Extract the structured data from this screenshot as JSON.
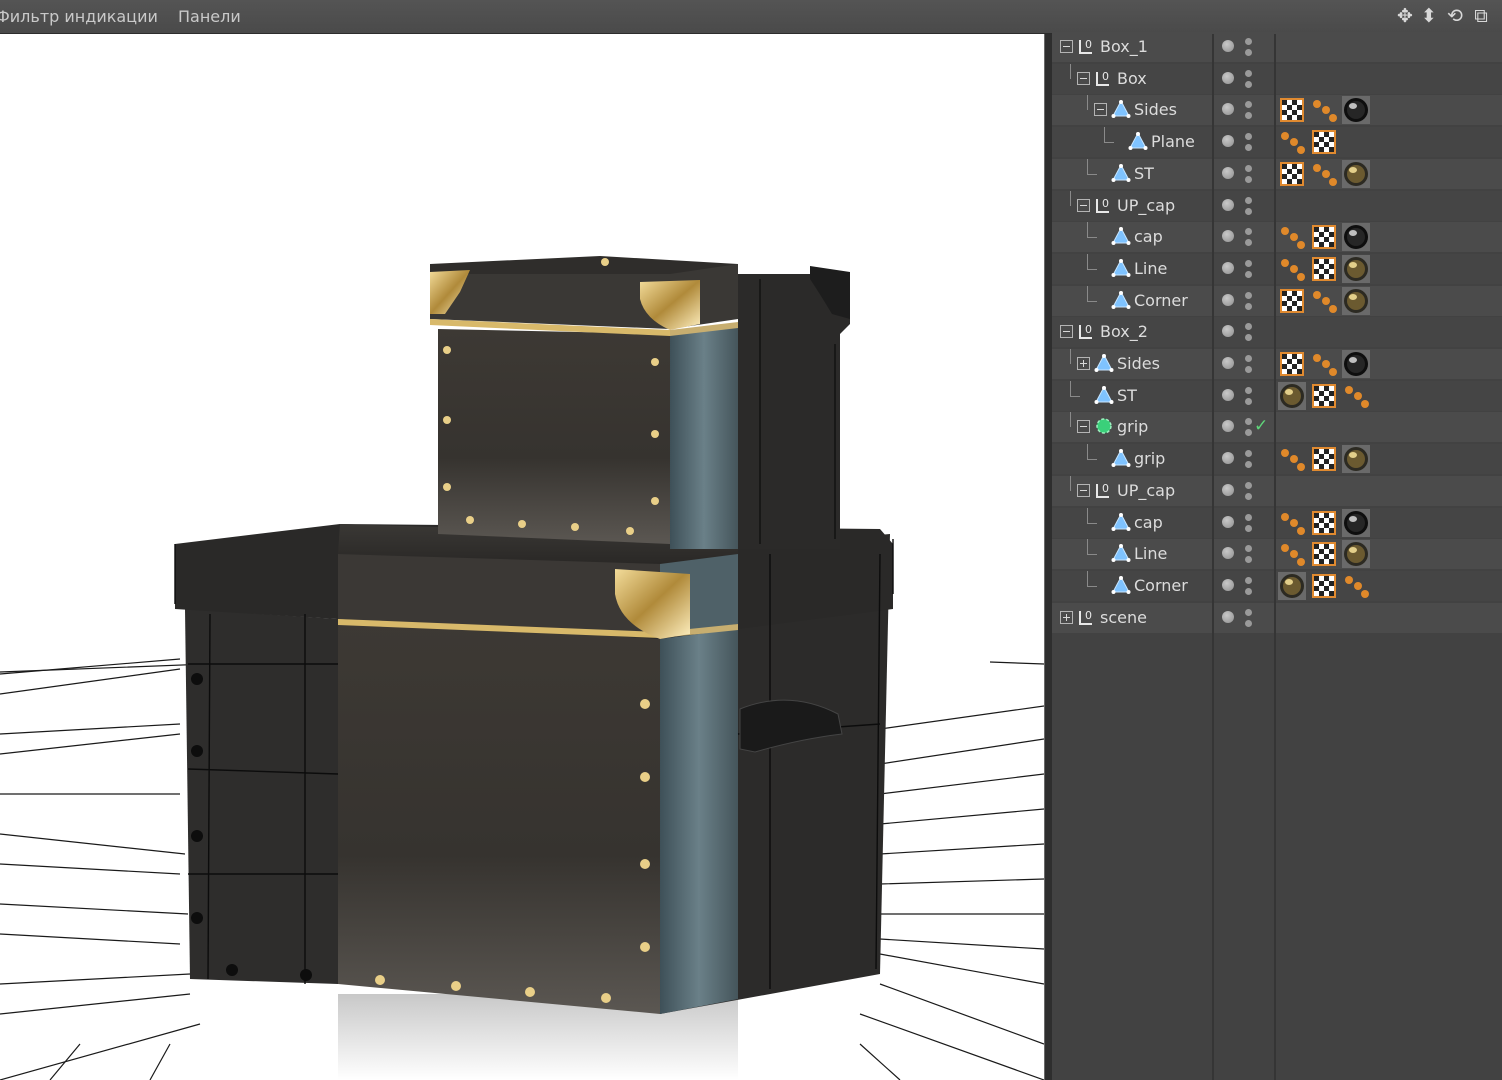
{
  "menu": {
    "items": [
      {
        "label": "Фильтр индикации"
      },
      {
        "label": "Панели"
      }
    ]
  },
  "toolbar": {
    "icons": [
      "move-icon",
      "down-arrow-icon",
      "rotate-icon",
      "window-icon"
    ]
  },
  "object_manager": {
    "objects": [
      {
        "name": "Box_1",
        "depth": 0,
        "kind": "null",
        "expander": "collapse",
        "tags": []
      },
      {
        "name": "Box",
        "depth": 1,
        "kind": "null",
        "expander": "collapse",
        "tags": []
      },
      {
        "name": "Sides",
        "depth": 2,
        "kind": "polygon",
        "expander": "collapse",
        "tags": [
          "texture-tag",
          "selection-tag",
          "material-tag-black"
        ]
      },
      {
        "name": "Plane",
        "depth": 3,
        "kind": "polygon",
        "expander": "none",
        "tags": [
          "selection-tag",
          "texture-tag"
        ]
      },
      {
        "name": "ST",
        "depth": 2,
        "kind": "polygon",
        "expander": "none",
        "tags": [
          "texture-tag",
          "selection-tag",
          "material-tag-gold"
        ]
      },
      {
        "name": "UP_cap",
        "depth": 1,
        "kind": "null",
        "expander": "collapse",
        "tags": []
      },
      {
        "name": "cap",
        "depth": 2,
        "kind": "polygon",
        "expander": "none",
        "tags": [
          "selection-tag",
          "texture-tag",
          "material-tag-black"
        ]
      },
      {
        "name": "Line",
        "depth": 2,
        "kind": "polygon",
        "expander": "none",
        "tags": [
          "selection-tag",
          "texture-tag",
          "material-tag-gold"
        ]
      },
      {
        "name": "Corner",
        "depth": 2,
        "kind": "polygon",
        "expander": "none",
        "tags": [
          "texture-tag",
          "selection-tag",
          "material-tag-gold"
        ]
      },
      {
        "name": "Box_2",
        "depth": 0,
        "kind": "null",
        "expander": "collapse",
        "tags": []
      },
      {
        "name": "Sides",
        "depth": 1,
        "kind": "polygon",
        "expander": "expand",
        "tags": [
          "texture-tag",
          "selection-tag",
          "material-tag-black"
        ]
      },
      {
        "name": "ST",
        "depth": 1,
        "kind": "polygon",
        "expander": "none",
        "tags": [
          "material-tag-gold",
          "texture-tag",
          "selection-tag"
        ]
      },
      {
        "name": "grip",
        "depth": 1,
        "kind": "generator",
        "expander": "collapse",
        "tags": [],
        "checked": true
      },
      {
        "name": "grip",
        "depth": 2,
        "kind": "polygon",
        "expander": "none",
        "tags": [
          "selection-tag",
          "texture-tag",
          "material-tag-gold"
        ]
      },
      {
        "name": "UP_cap",
        "depth": 1,
        "kind": "null",
        "expander": "collapse",
        "tags": []
      },
      {
        "name": "cap",
        "depth": 2,
        "kind": "polygon",
        "expander": "none",
        "tags": [
          "selection-tag",
          "texture-tag",
          "material-tag-black"
        ]
      },
      {
        "name": "Line",
        "depth": 2,
        "kind": "polygon",
        "expander": "none",
        "tags": [
          "selection-tag",
          "texture-tag",
          "material-tag-gold"
        ]
      },
      {
        "name": "Corner",
        "depth": 2,
        "kind": "polygon",
        "expander": "none",
        "tags": [
          "material-tag-gold",
          "texture-tag",
          "selection-tag"
        ]
      },
      {
        "name": "scene",
        "depth": 0,
        "kind": "null",
        "expander": "expand",
        "tags": []
      }
    ]
  },
  "colors": {
    "ui_background": "#424242",
    "selection_tag": "#e0892a",
    "texture_tag_border": "#e08a30",
    "gold": "#c9a14a",
    "box_dark": "#3a3632",
    "generator_green": "#3ad07a"
  }
}
